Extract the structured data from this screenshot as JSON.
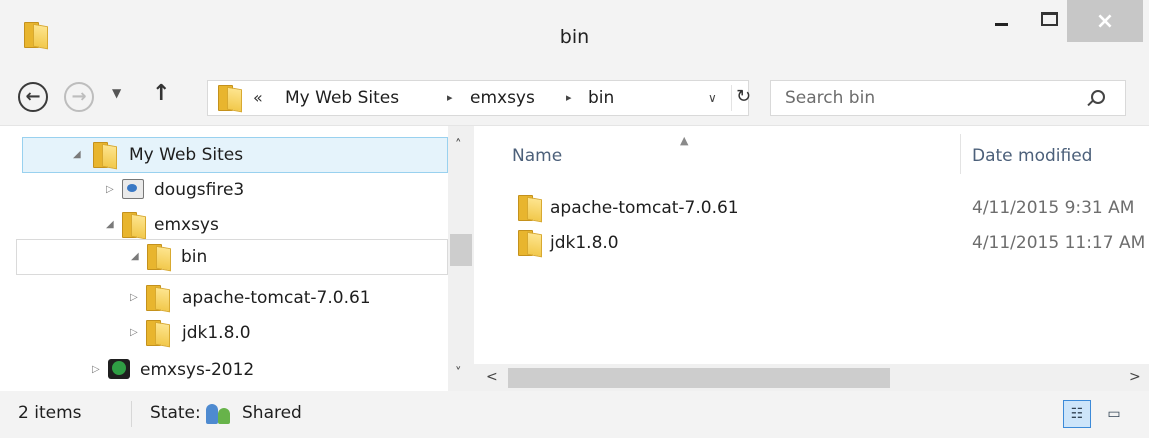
{
  "window": {
    "title": "bin",
    "close_glyph": "×"
  },
  "nav": {
    "back_glyph": "←",
    "forward_glyph": "→",
    "recent_glyph": "▼",
    "up_glyph": "↑"
  },
  "address": {
    "overflow": "«",
    "separator": "▸",
    "crumbs": [
      "My Web Sites",
      "emxsys",
      "bin"
    ],
    "dropdown_glyph": "∨",
    "refresh_glyph": "↻"
  },
  "search": {
    "placeholder": "Search bin"
  },
  "tree": {
    "expanded_glyph": "◢",
    "collapsed_glyph": "▷",
    "items": [
      {
        "label": "My Web Sites",
        "state": "expanded",
        "icon": "folder-icon",
        "selected": true
      },
      {
        "label": "dougsfire3",
        "state": "collapsed",
        "icon": "web-folder-icon"
      },
      {
        "label": "emxsys",
        "state": "expanded",
        "icon": "folder-icon"
      },
      {
        "label": "bin",
        "state": "expanded",
        "icon": "folder-icon",
        "focused": true
      },
      {
        "label": "apache-tomcat-7.0.61",
        "state": "collapsed",
        "icon": "folder-icon"
      },
      {
        "label": "jdk1.8.0",
        "state": "collapsed",
        "icon": "folder-icon"
      },
      {
        "label": "emxsys-2012",
        "state": "collapsed",
        "icon": "iis-site-icon"
      }
    ]
  },
  "filelist": {
    "sort_glyph": "▲",
    "columns": {
      "name": "Name",
      "date": "Date modified"
    },
    "rows": [
      {
        "name": "apache-tomcat-7.0.61",
        "date": "4/11/2015 9:31 AM"
      },
      {
        "name": "jdk1.8.0",
        "date": "4/11/2015 11:17 AM"
      }
    ]
  },
  "scroll": {
    "up_glyph": "˄",
    "down_glyph": "˅",
    "left_glyph": "<",
    "right_glyph": ">"
  },
  "status": {
    "count": "2 items",
    "state_label": "State:",
    "state_value": "Shared",
    "details_glyph": "☷",
    "tiles_glyph": "▭"
  },
  "colors": {
    "selection_bg": "#e5f3fb",
    "selection_border": "#99d1ef",
    "folder": "#f2c94c",
    "column_header": "#4c607a"
  }
}
